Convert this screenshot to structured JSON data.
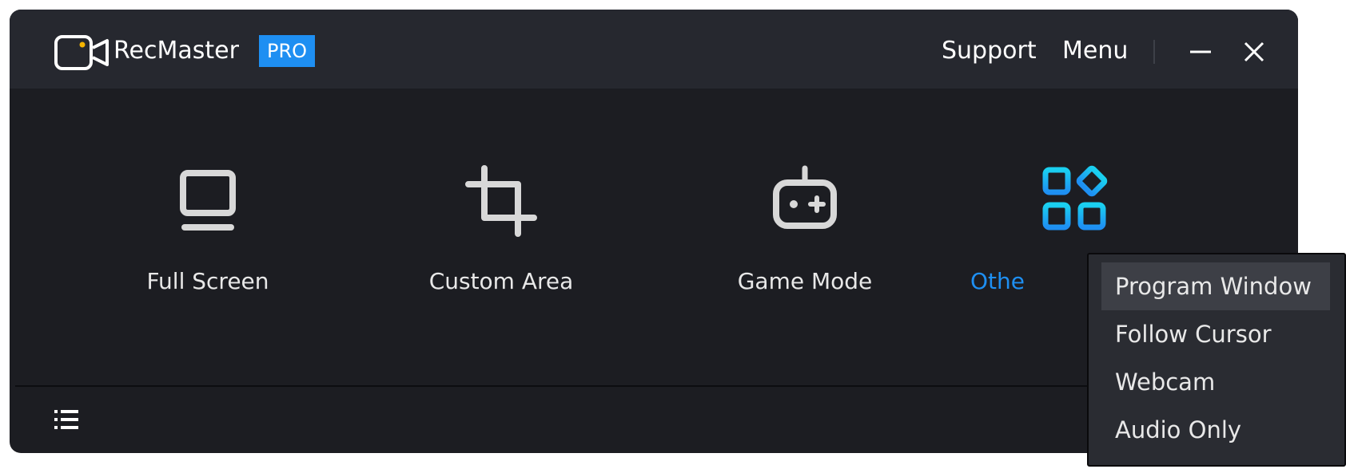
{
  "app": {
    "name": "RecMaster",
    "badge": "PRO",
    "logo_icon": "camera-logo",
    "accent_color": "#1e8ff2",
    "logo_dot_color": "#f5b400"
  },
  "topbar": {
    "support_label": "Support",
    "menu_label": "Menu",
    "minimize_icon": "minimize-icon",
    "close_icon": "close-icon"
  },
  "modes": [
    {
      "label": "Full Screen",
      "icon": "monitor-icon"
    },
    {
      "label": "Custom Area",
      "icon": "crop-icon"
    },
    {
      "label": "Game Mode",
      "icon": "gamepad-icon"
    },
    {
      "label": "Other",
      "icon": "apps-grid-icon",
      "active": true,
      "visible_label": "Othe"
    }
  ],
  "footer": {
    "list_icon": "list-icon"
  },
  "dropdown": {
    "items": [
      {
        "label": "Program Window",
        "selected": true
      },
      {
        "label": "Follow Cursor"
      },
      {
        "label": "Webcam"
      },
      {
        "label": "Audio Only"
      }
    ]
  }
}
